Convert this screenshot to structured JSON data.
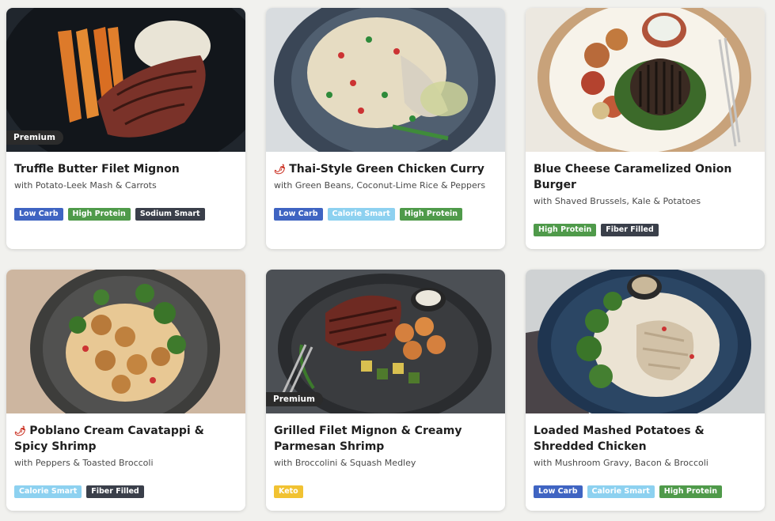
{
  "colors": {
    "Low Carb": "#3f64c2",
    "High Protein": "#4f9a4a",
    "Sodium Smart": "#3a3f4a",
    "Calorie Smart": "#8dd1f0",
    "Fiber Filled": "#3a3f4a",
    "Keto": "#f1c232",
    "chili": "#c92a1b"
  },
  "cards": [
    {
      "title": "Truffle Butter Filet Mignon",
      "subtitle": "with Potato-Leek Mash & Carrots",
      "premium": "Premium",
      "spicy": false,
      "badges": [
        "Low Carb",
        "High Protein",
        "Sodium Smart"
      ]
    },
    {
      "title": "Thai-Style Green Chicken Curry",
      "subtitle": "with Green Beans, Coconut-Lime Rice & Peppers",
      "premium": "",
      "spicy": true,
      "badges": [
        "Low Carb",
        "Calorie Smart",
        "High Protein"
      ]
    },
    {
      "title": "Blue Cheese Caramelized Onion Burger",
      "subtitle": "with Shaved Brussels, Kale & Potatoes",
      "premium": "",
      "spicy": false,
      "badges": [
        "High Protein",
        "Fiber Filled"
      ]
    },
    {
      "title": "Poblano Cream Cavatappi & Spicy Shrimp",
      "subtitle": "with Peppers & Toasted Broccoli",
      "premium": "",
      "spicy": true,
      "badges": [
        "Calorie Smart",
        "Fiber Filled"
      ]
    },
    {
      "title": "Grilled Filet Mignon & Creamy Parmesan Shrimp",
      "subtitle": "with Broccolini & Squash Medley",
      "premium": "Premium",
      "spicy": false,
      "badges": [
        "Keto"
      ]
    },
    {
      "title": "Loaded Mashed Potatoes & Shredded Chicken",
      "subtitle": "with Mushroom Gravy, Bacon & Broccoli",
      "premium": "",
      "spicy": false,
      "badges": [
        "Low Carb",
        "Calorie Smart",
        "High Protein"
      ]
    }
  ]
}
